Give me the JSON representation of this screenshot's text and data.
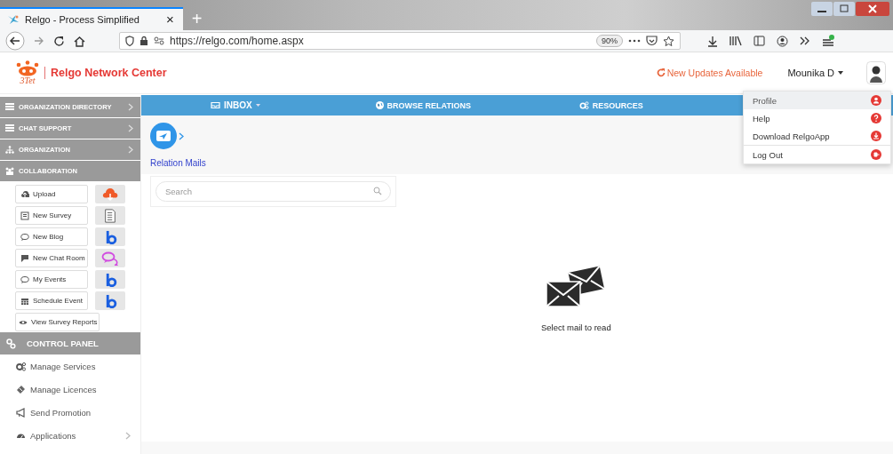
{
  "browser": {
    "tab_title": "Relgo - Process Simplified",
    "tab_close": "×",
    "new_tab": "+",
    "url": "https://relgo.com/home.aspx",
    "zoom": "90%"
  },
  "header": {
    "brand": "Relgo Network Center",
    "logo_text": "3Tet",
    "updates": "New Updates Available",
    "user": "Mounika D"
  },
  "sidebar": {
    "sections": [
      {
        "label": "ORGANIZATION DIRECTORY",
        "chevron": true
      },
      {
        "label": "CHAT SUPPORT",
        "chevron": true
      },
      {
        "label": "ORGANIZATION",
        "chevron": true
      },
      {
        "label": "COLLABORATION",
        "chevron": false
      }
    ],
    "collaboration": [
      {
        "label": "Upload",
        "tile": true
      },
      {
        "label": "New Survey",
        "tile": true
      },
      {
        "label": "New Blog",
        "tile": true
      },
      {
        "label": "New Chat Room",
        "tile": true
      },
      {
        "label": "My Events",
        "tile": true
      },
      {
        "label": "Schedule Event",
        "tile": true
      },
      {
        "label": "View Survey Reports",
        "tile": false
      }
    ],
    "control_panel": "CONTROL PANEL",
    "control_items": [
      {
        "label": "Manage Services",
        "chevron": false
      },
      {
        "label": "Manage Licences",
        "chevron": false
      },
      {
        "label": "Send Promotion",
        "chevron": false
      },
      {
        "label": "Applications",
        "chevron": true
      }
    ]
  },
  "nav": [
    {
      "label": "INBOX",
      "dropdown": true
    },
    {
      "label": "BROWSE RELATIONS",
      "dropdown": false
    },
    {
      "label": "RESOURCES",
      "dropdown": false
    }
  ],
  "inbox": {
    "breadcrumb": "Relation Mails",
    "search": {
      "placeholder": "Search"
    },
    "empty": "Select mail to read"
  },
  "user_menu": [
    {
      "label": "Profile",
      "selected": true,
      "divider_before": false
    },
    {
      "label": "Help",
      "selected": false,
      "divider_before": false
    },
    {
      "label": "Download RelgoApp",
      "selected": false,
      "divider_before": false
    },
    {
      "label": "Log Out",
      "selected": false,
      "divider_before": true
    }
  ]
}
